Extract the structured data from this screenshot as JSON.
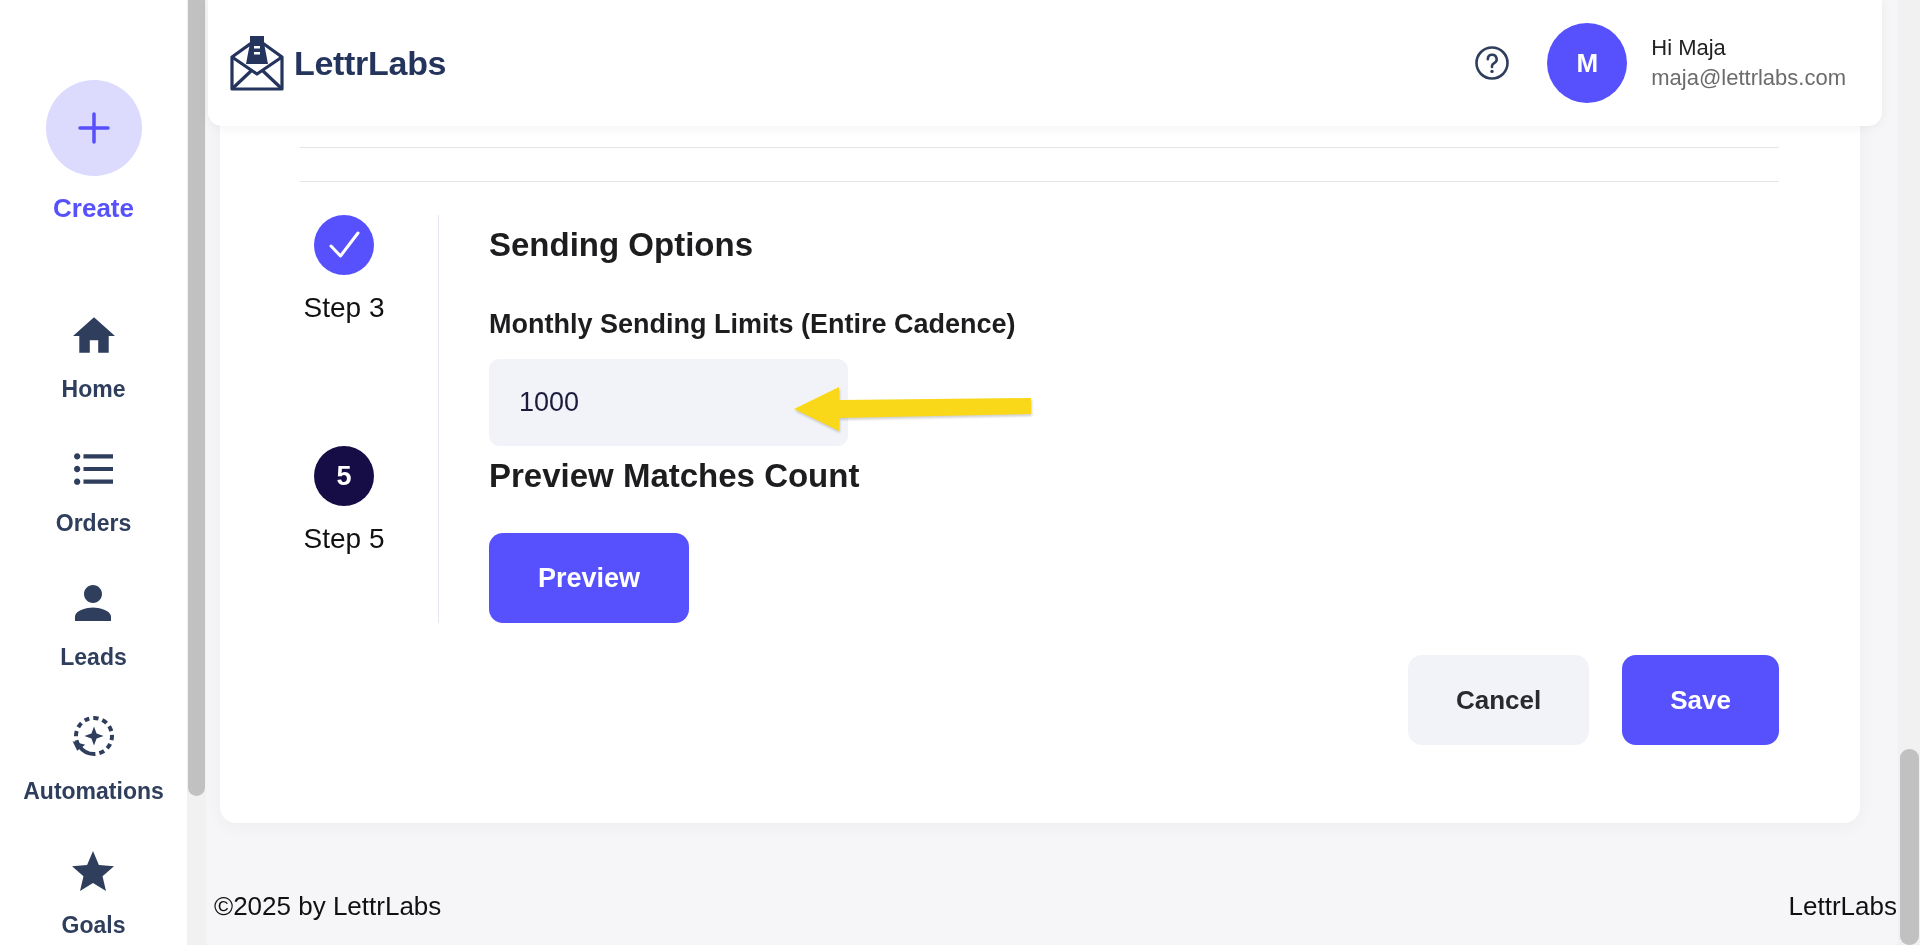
{
  "sidebar": {
    "create": {
      "label": "Create"
    },
    "items": [
      {
        "label": "Home",
        "selected": false
      },
      {
        "label": "Orders",
        "selected": false
      },
      {
        "label": "Leads",
        "selected": false
      },
      {
        "label": "Automations",
        "selected": false
      },
      {
        "label": "Goals",
        "selected": false
      }
    ]
  },
  "header": {
    "logo": "LettrLabs",
    "user": {
      "initial": "M",
      "greeting": "Hi Maja",
      "email": "maja@lettrlabs.com"
    }
  },
  "steps": [
    {
      "completed": true,
      "label": "Step 3",
      "title": "Sending Options",
      "field": {
        "label": "Monthly Sending Limits (Entire Cadence)",
        "value": "1000"
      }
    },
    {
      "completed": false,
      "number": "5",
      "label": "Step 5",
      "title": "Preview Matches Count",
      "button": "Preview"
    }
  ],
  "actions": [
    {
      "label": "Cancel",
      "kind": "secondary"
    },
    {
      "label": "Save",
      "kind": "primary"
    }
  ],
  "footer": {
    "copyright": "©2025 by LettrLabs",
    "brand": "LettrLabs"
  }
}
